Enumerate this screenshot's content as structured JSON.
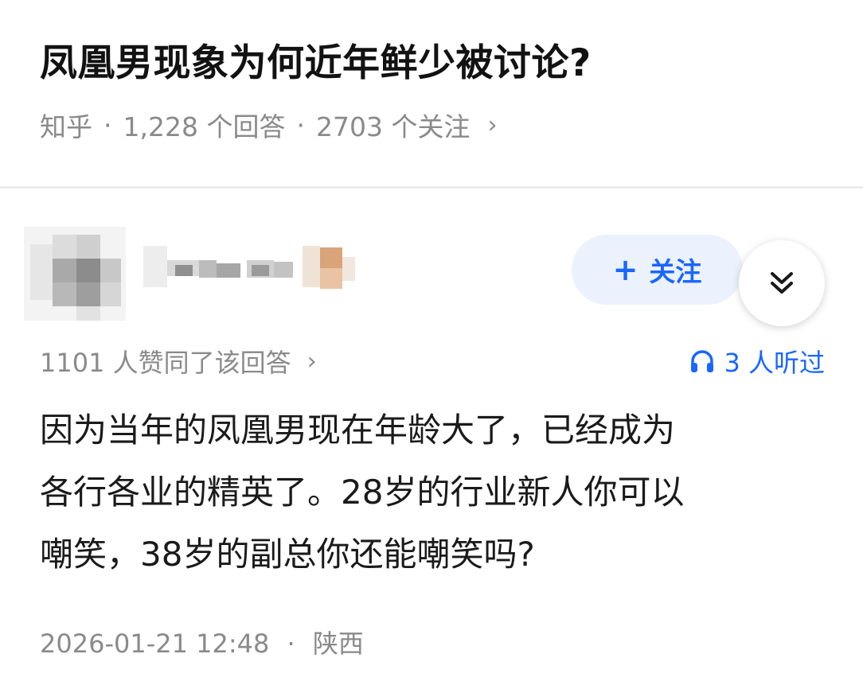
{
  "question": {
    "title": "凤凰男现象为何近年鲜少被讨论?",
    "source": "知乎",
    "answers": "1,228 个回答",
    "followers": "2703 个关注",
    "chevron": "›"
  },
  "author": {
    "avatar_icon": "pixelated-avatar",
    "name_obscured": true,
    "follow_label": "关注",
    "follow_icon": "plus-icon",
    "expand_icon": "double-chevron-down-icon"
  },
  "stats": {
    "votes": "1101 人赞同了该回答",
    "chevron": "›",
    "listened": "3 人听过",
    "listened_icon": "headphones-icon"
  },
  "answer": {
    "lines": [
      "因为当年的凤凰男现在年龄大了，已经成为",
      "各行各业的精英了。28岁的行业新人你可以",
      "嘲笑，38岁的副总你还能嘲笑吗?"
    ]
  },
  "footer": {
    "datetime": "2026-01-21 12:48",
    "location": "陕西"
  },
  "colors": {
    "accent": "#1a66ff",
    "follow_bg": "#ebf2fd",
    "meta_gray": "#8a8a8a",
    "divider": "#ebebeb"
  }
}
